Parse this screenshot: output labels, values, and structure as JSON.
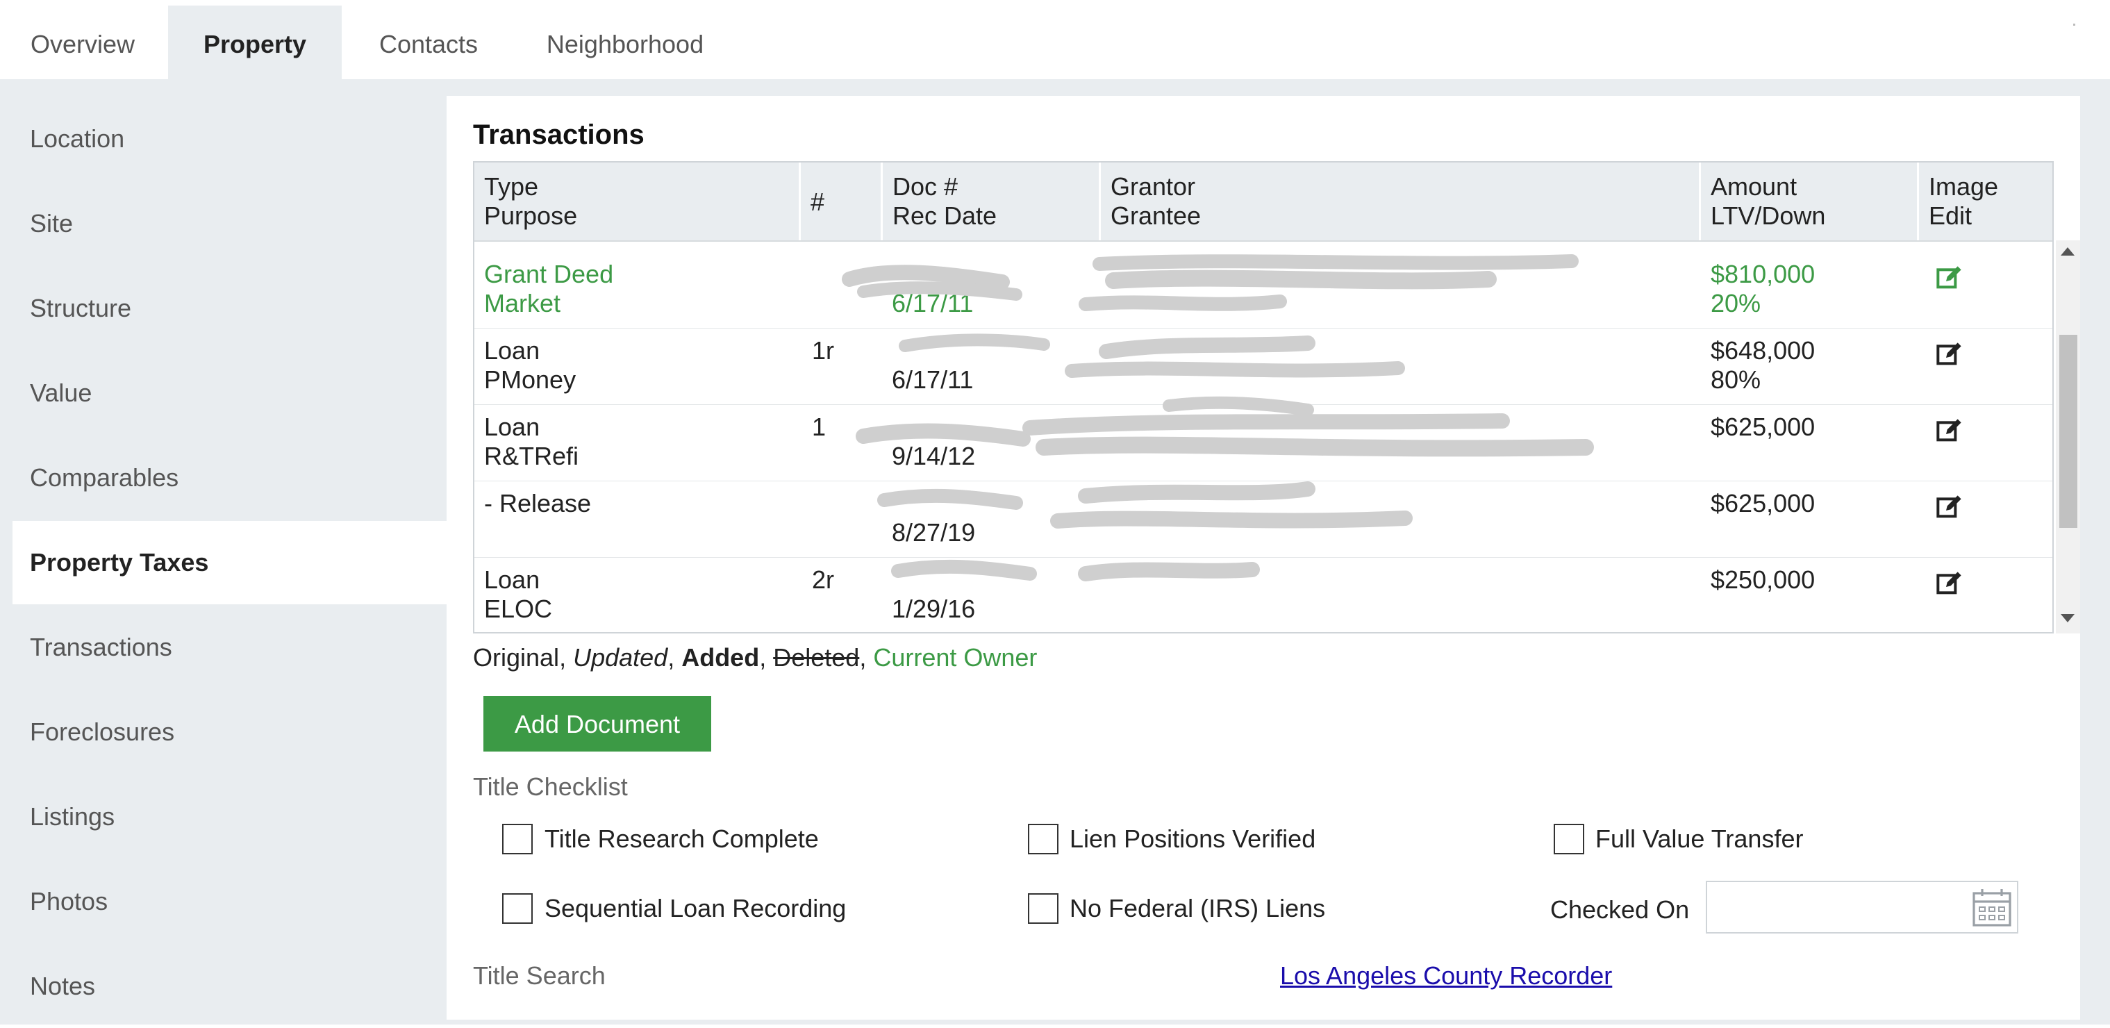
{
  "tabs": [
    "Overview",
    "Property",
    "Contacts",
    "Neighborhood"
  ],
  "sidebar": [
    "Location",
    "Site",
    "Structure",
    "Value",
    "Comparables",
    "Property Taxes",
    "Transactions",
    "Foreclosures",
    "Listings",
    "Photos",
    "Notes"
  ],
  "section_title": "Transactions",
  "grid": {
    "headers": [
      {
        "line1": "Type",
        "line2": "Purpose"
      },
      {
        "line1": "#",
        "line2": ""
      },
      {
        "line1": "Doc #",
        "line2": "Rec Date"
      },
      {
        "line1": "Grantor",
        "line2": "Grantee"
      },
      {
        "line1": "Amount",
        "line2": "LTV/Down"
      },
      {
        "line1": "Image",
        "line2": "Edit"
      }
    ],
    "rows": [
      {
        "type": "Grant Deed",
        "purpose": "Market",
        "num": "",
        "doc": "",
        "date": "6/17/11",
        "grantor": "",
        "grantee": "",
        "amount": "$810,000",
        "ltv": "20%",
        "current_owner": true
      },
      {
        "type": "Loan",
        "purpose": "PMoney",
        "num": "1r",
        "doc": "",
        "date": "6/17/11",
        "grantor": "",
        "grantee": "",
        "amount": "$648,000",
        "ltv": "80%",
        "current_owner": false
      },
      {
        "type": "Loan",
        "purpose": "R&TRefi",
        "num": "1",
        "doc": "",
        "date": "9/14/12",
        "grantor": "",
        "grantee": "",
        "amount": "$625,000",
        "ltv": "",
        "current_owner": false
      },
      {
        "type": "- Release",
        "purpose": "",
        "num": "",
        "doc": "",
        "date": "8/27/19",
        "grantor": "",
        "grantee": "",
        "amount": "$625,000",
        "ltv": "",
        "current_owner": false
      },
      {
        "type": "Loan",
        "purpose": "ELOC",
        "num": "2r",
        "doc": "",
        "date": "1/29/16",
        "grantor": "",
        "grantee": "",
        "amount": "$250,000",
        "ltv": "",
        "current_owner": false
      }
    ]
  },
  "legend": {
    "original": "Original",
    "updated": "Updated",
    "added": "Added",
    "deleted": "Deleted",
    "current_owner": "Current Owner",
    "sep": ", "
  },
  "add_document_label": "Add Document",
  "title_checklist": {
    "label": "Title Checklist",
    "items": [
      "Title Research Complete",
      "Lien Positions Verified",
      "Full Value Transfer",
      "Sequential Loan Recording",
      "No Federal (IRS) Liens"
    ],
    "checked_on_label": "Checked On",
    "checked_on_value": ""
  },
  "title_search": {
    "label": "Title Search",
    "link": "Los Angeles County Recorder"
  },
  "colors": {
    "accent_green": "#3c9a45",
    "panel_gray": "#e9edf0",
    "link_blue": "#1a0dab"
  },
  "icons": {
    "edit": "edit-icon",
    "calendar": "calendar-icon"
  }
}
